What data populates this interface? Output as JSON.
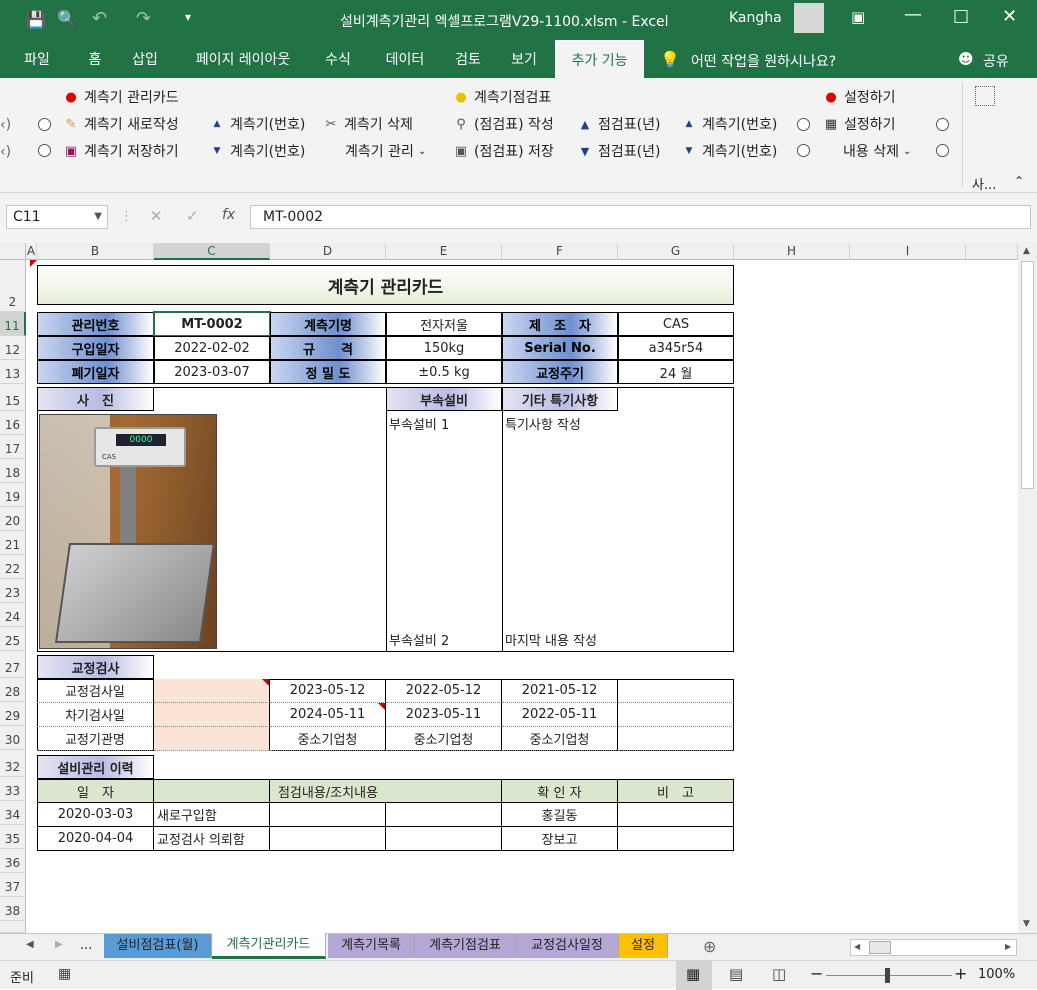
{
  "titlebar": {
    "title": "설비계측기관리 엑셀프로그램V29-1100.xlsm  -  Excel",
    "user": "Kangha",
    "undo": "↶",
    "redo": "↷"
  },
  "tabs": [
    "파일",
    "홈",
    "삽입",
    "페이지 레이아웃",
    "수식",
    "데이터",
    "검토",
    "보기",
    "추가 기능"
  ],
  "tell_me": "어떤 작업을 원하시나요?",
  "share": "공유",
  "ribbon": {
    "group1_title": "계측기 관리카드",
    "btn_new": "계측기 새로작성",
    "btn_save": "계측기 저장하기",
    "btn_prev": "계측기(번호)",
    "btn_next": "계측기(번호)",
    "btn_delete": "계측기 삭제",
    "btn_manage": "계측기 관리",
    "group2_title": "계측기점검표",
    "btn_chk_write": "(점검표) 작성",
    "btn_chk_save": "(점검표) 저장",
    "btn_year_up": "점검표(년)",
    "btn_year_down": "점검표(년)",
    "btn_num_up": "계측기(번호)",
    "btn_num_down": "계측기(번호)",
    "group3_title": "설정하기",
    "btn_setting": "설정하기",
    "btn_clear": "내용 삭제",
    "more_label": "사...",
    "left_cut1": "‹)",
    "left_cut2": "‹)"
  },
  "formula": {
    "namebox": "C11",
    "content": "MT-0002",
    "fx": "fx"
  },
  "columns": [
    "A",
    "B",
    "C",
    "D",
    "E",
    "F",
    "G",
    "H",
    "I"
  ],
  "rows": [
    "2",
    "11",
    "12",
    "13",
    "15",
    "16",
    "17",
    "18",
    "19",
    "20",
    "21",
    "22",
    "23",
    "24",
    "25",
    "27",
    "28",
    "29",
    "30",
    "32",
    "33",
    "34",
    "35",
    "36",
    "37",
    "38"
  ],
  "card": {
    "title": "계측기 관리카드",
    "labels": {
      "mgmt_no": "관리번호",
      "purchase": "구입일자",
      "disposal": "폐기일자",
      "name": "계측기명",
      "spec": "규　　격",
      "precision": "정 밀 도",
      "maker": "제　조　자",
      "serial": "Serial No.",
      "cycle": "교정주기"
    },
    "values": {
      "mgmt_no": "MT-0002",
      "purchase": "2022-02-02",
      "disposal": "2023-03-07",
      "name": "전자저울",
      "spec": "150kg",
      "precision": "±0.5 kg",
      "maker": "CAS",
      "serial": "a345r54",
      "cycle": "24 월"
    },
    "photo_label": "사　진",
    "acc_label": "부속설비",
    "note_label": "기타 특기사항",
    "acc1": "부속설비 1",
    "acc2": "부속설비  2",
    "note1": "특기사항 작성",
    "note2": "마지막 내용 작성",
    "scale_brand": "CAS",
    "scale_display": "0000"
  },
  "calib": {
    "title": "교정검사",
    "rows": [
      {
        "label": "교정검사일",
        "values": [
          "",
          "2023-05-12",
          "2022-05-12",
          "2021-05-12",
          ""
        ]
      },
      {
        "label": "차기검사일",
        "values": [
          "",
          "2024-05-11",
          "2023-05-11",
          "2022-05-11",
          ""
        ]
      },
      {
        "label": "교정기관명",
        "values": [
          "",
          "중소기업청",
          "중소기업청",
          "중소기업청",
          ""
        ]
      }
    ]
  },
  "history": {
    "title": "설비관리 이력",
    "headers": [
      "일　자",
      "",
      "점검내용/조치내용",
      "",
      "확 인 자",
      "비　고"
    ],
    "rows": [
      [
        "2020-03-03",
        "새로구입함",
        "",
        "",
        "홍길동",
        ""
      ],
      [
        "2020-04-04",
        "교정검사 의뢰함",
        "",
        "",
        "장보고",
        ""
      ]
    ]
  },
  "sheets": [
    {
      "name": "설비점검표(월)",
      "color": "#5b9bd5"
    },
    {
      "name": "계측기관리카드",
      "color": "#ffffff"
    },
    {
      "name": "계측기목록",
      "color": "#b4a7d6"
    },
    {
      "name": "계측기점검표",
      "color": "#b4a7d6"
    },
    {
      "name": "교정검사일정",
      "color": "#b4a7d6"
    },
    {
      "name": "설정",
      "color": "#ffc000"
    }
  ],
  "status": {
    "ready": "준비",
    "zoom": "100%",
    "minus": "−",
    "plus": "+",
    "ellipsis": "..."
  }
}
